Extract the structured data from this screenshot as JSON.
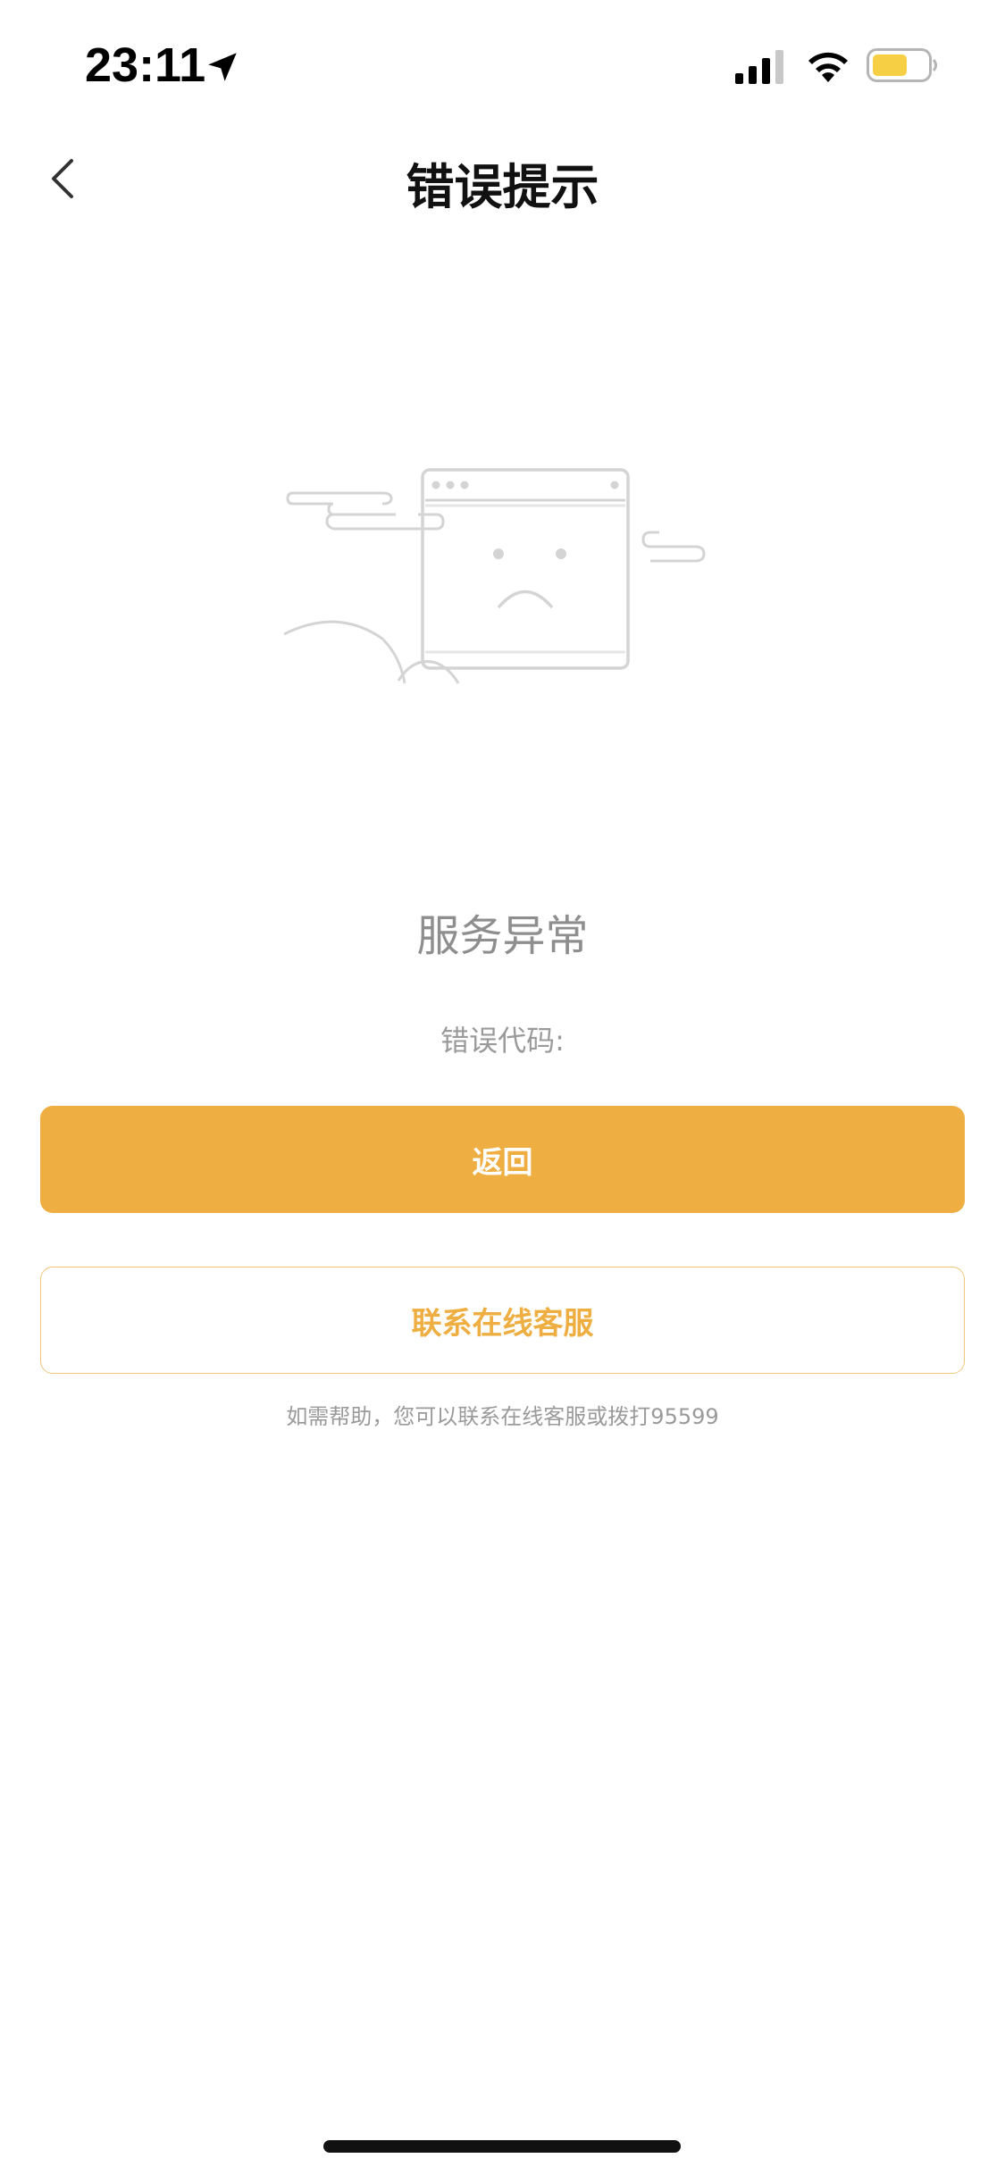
{
  "status_bar": {
    "time": "23:11",
    "icons": [
      "location-arrow-icon",
      "signal-icon",
      "wifi-icon",
      "battery-icon"
    ],
    "battery_color": "#f7cf45"
  },
  "nav": {
    "title": "错误提示",
    "back_icon": "chevron-left-icon"
  },
  "illustration": {
    "icon": "sad-browser-window-illustration"
  },
  "error": {
    "title": "服务异常",
    "code_label": "错误代码:"
  },
  "actions": {
    "back_label": "返回",
    "contact_label": "联系在线客服"
  },
  "help": {
    "text": "如需帮助，您可以联系在线客服或拨打95599"
  },
  "colors": {
    "accent": "#efae41",
    "accent_border": "#f2c77a",
    "muted_text": "#9a9a9a"
  }
}
